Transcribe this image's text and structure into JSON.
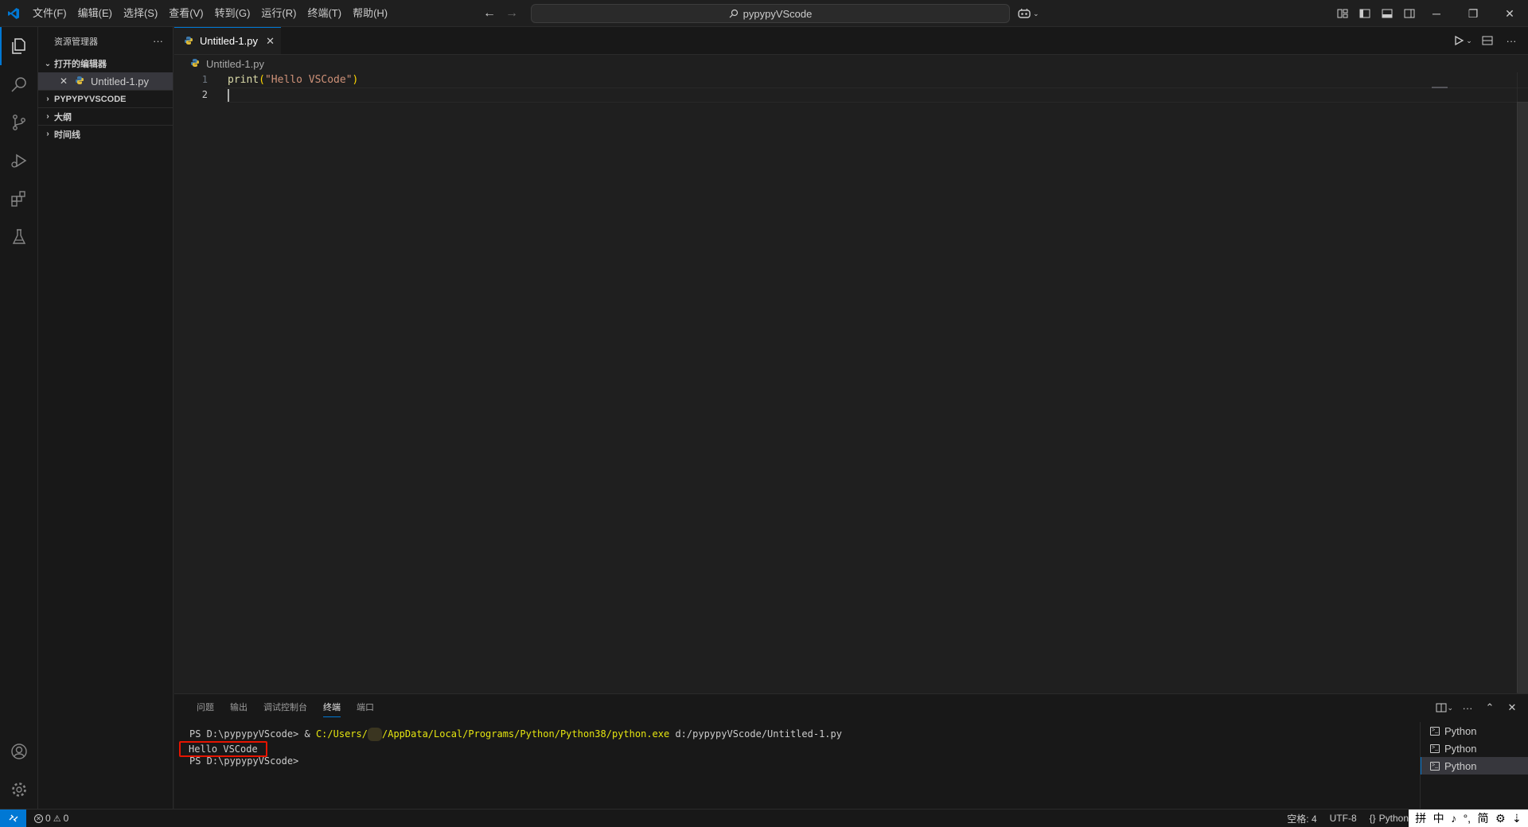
{
  "titlebar": {
    "menus": [
      "文件(F)",
      "编辑(E)",
      "选择(S)",
      "查看(V)",
      "转到(G)",
      "运行(R)",
      "终端(T)",
      "帮助(H)"
    ],
    "search_text": "pypypyVScode"
  },
  "sidebar": {
    "title": "资源管理器",
    "more": "···",
    "open_editors_label": "打开的编辑器",
    "open_file": "Untitled-1.py",
    "folder_label": "PYPYPYVSCODE",
    "outline_label": "大纲",
    "timeline_label": "时间线"
  },
  "editor": {
    "tab_label": "Untitled-1.py",
    "breadcrumb": "Untitled-1.py",
    "lines": [
      {
        "num": "1",
        "fn": "print",
        "open": "(",
        "str": "\"Hello VSCode\"",
        "close": ")"
      },
      {
        "num": "2"
      }
    ]
  },
  "panel": {
    "tabs": [
      "问题",
      "输出",
      "调试控制台",
      "终端",
      "端口"
    ],
    "active_tab": "终端",
    "terminal": {
      "line1_prompt": "PS D:\\pypypyVScode> & ",
      "line1_path": "C:/Users/",
      "line1_path_rest": "AppData/Local/Programs/Python/Python38/python.exe",
      "line1_arg": " d:/pypypyVScode/Untitled-1.py",
      "line2": "Hello VSCode",
      "line3": "PS D:\\pypypyVScode>"
    },
    "terminal_list": [
      "Python",
      "Python",
      "Python"
    ]
  },
  "statusbar": {
    "errors": "0",
    "warnings": "0",
    "indent": "空格: 4",
    "encoding": "UTF-8",
    "language": "Python",
    "ime_items": [
      "拼",
      "中",
      "♪",
      "°,",
      "简",
      "⚙",
      "⇣"
    ]
  },
  "colors": {
    "accent": "#0078d4",
    "highlight_box": "#e51400"
  }
}
